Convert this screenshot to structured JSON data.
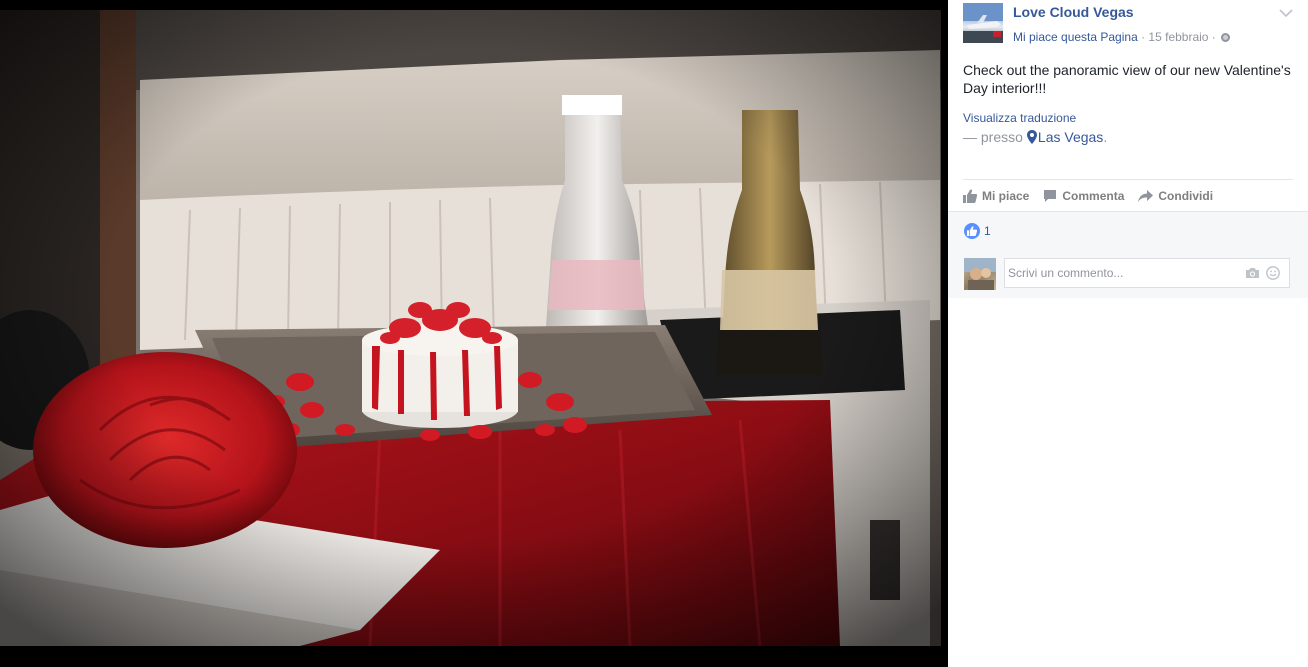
{
  "photo": {
    "alt_icon": "photo-of-dessert-rose-and-champagne"
  },
  "post": {
    "page_name": "Love Cloud Vegas",
    "like_page": "Mi piace questa Pagina",
    "separator": " · ",
    "date": "15 febbraio",
    "text": "Check out the panoramic view of our new Valentine's Day interior!!!",
    "see_translation": "Visualizza traduzione",
    "location_prefix": "— presso",
    "location": "Las Vegas",
    "location_suffix": ".",
    "privacy_icon": "globe-icon",
    "options_icon": "chevron-down-icon"
  },
  "actions": {
    "like": "Mi piace",
    "comment": "Commenta",
    "share": "Condividi"
  },
  "feedback": {
    "reaction_count": "1",
    "comment_placeholder": "Scrivi un commento..."
  },
  "colors": {
    "link": "#365899",
    "meta": "#90949c",
    "like_badge": "#5890ff"
  }
}
